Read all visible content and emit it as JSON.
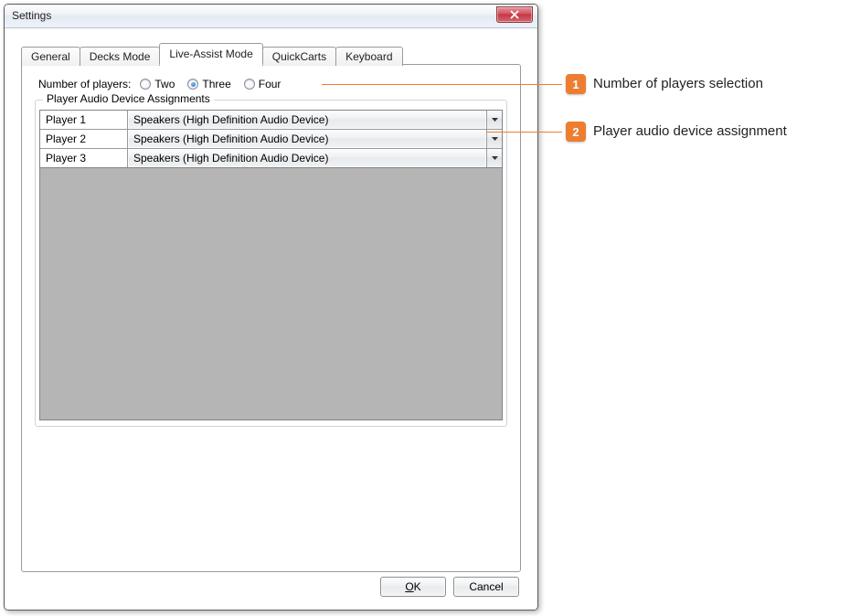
{
  "window": {
    "title": "Settings"
  },
  "tabs": {
    "general": "General",
    "decks": "Decks Mode",
    "live": "Live-Assist Mode",
    "quick": "QuickCarts",
    "keyboard": "Keyboard"
  },
  "players_label": "Number of players:",
  "radios": {
    "two": "Two",
    "three": "Three",
    "four": "Four"
  },
  "fieldset_title": "Player Audio Device Assignments",
  "rows": [
    {
      "label": "Player 1",
      "value": "Speakers (High Definition Audio Device)"
    },
    {
      "label": "Player 2",
      "value": "Speakers (High Definition Audio Device)"
    },
    {
      "label": "Player 3",
      "value": "Speakers (High Definition Audio Device)"
    }
  ],
  "buttons": {
    "ok_pre": "",
    "ok_u": "O",
    "ok_post": "K",
    "cancel": "Cancel"
  },
  "annotations": {
    "n1": "1",
    "t1": "Number of players selection",
    "n2": "2",
    "t2": "Player audio device assignment"
  }
}
